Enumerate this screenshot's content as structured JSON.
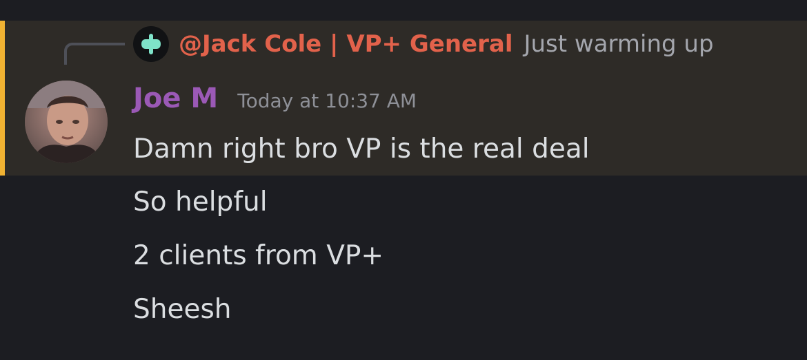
{
  "reply": {
    "author": "@Jack Cole | VP+ General",
    "snippet": "Just warming up",
    "avatar_icon": "vp-plus-logo-icon"
  },
  "message": {
    "author": "Joe M",
    "timestamp": "Today at 10:37 AM",
    "lines": [
      "Damn right bro VP is the real deal",
      "So helpful",
      "2 clients from VP+",
      "Sheesh"
    ]
  },
  "colors": {
    "background": "#1c1d22",
    "highlight": "#2e2b27",
    "highlight_bar": "#f0b232",
    "reply_author": "#e2624b",
    "username": "#9b59b6",
    "text": "#dbdee1",
    "muted": "#8e9097"
  }
}
